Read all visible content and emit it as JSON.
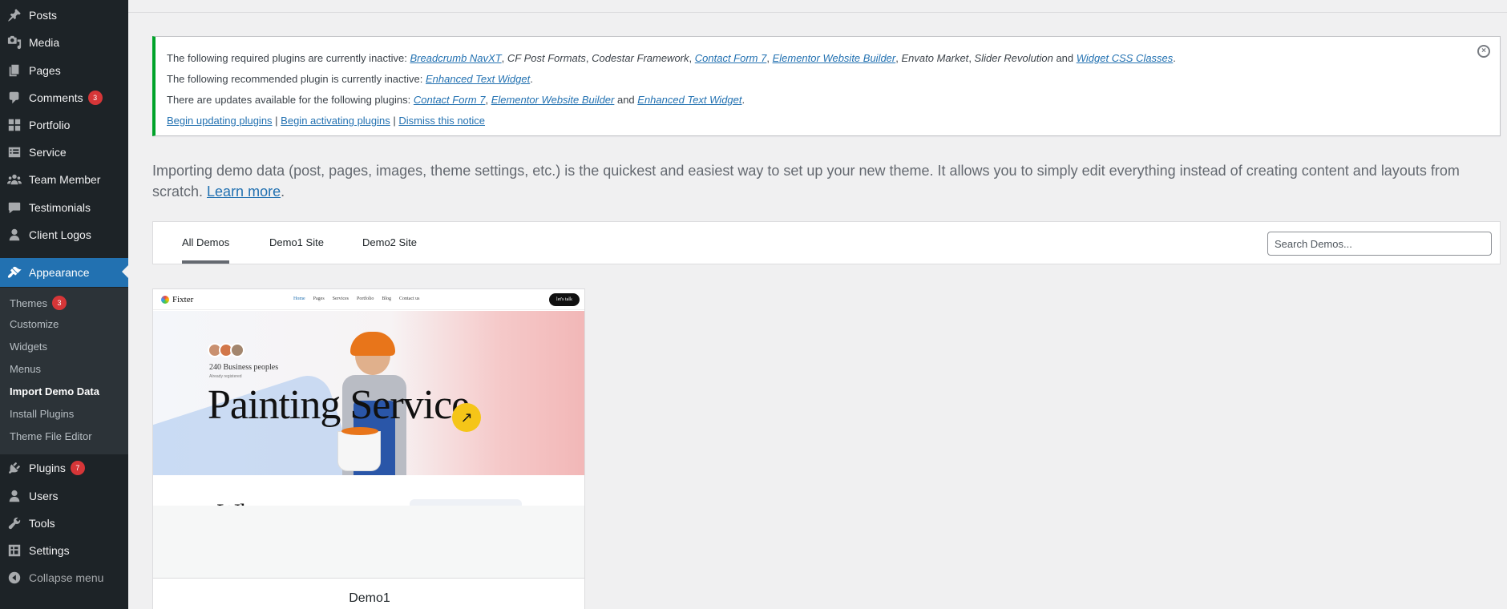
{
  "sidebar": {
    "items": [
      {
        "label": "Posts",
        "icon": "pin-icon"
      },
      {
        "label": "Media",
        "icon": "media-icon"
      },
      {
        "label": "Pages",
        "icon": "pages-icon"
      },
      {
        "label": "Comments",
        "icon": "comment-icon",
        "badge": "3"
      },
      {
        "label": "Portfolio",
        "icon": "grid-icon"
      },
      {
        "label": "Service",
        "icon": "list-icon"
      },
      {
        "label": "Team Member",
        "icon": "team-icon"
      },
      {
        "label": "Testimonials",
        "icon": "chat-icon"
      },
      {
        "label": "Client Logos",
        "icon": "user-icon"
      },
      {
        "label": "Appearance",
        "icon": "brush-icon"
      },
      {
        "label": "Plugins",
        "icon": "plug-icon",
        "badge": "7"
      },
      {
        "label": "Users",
        "icon": "users-icon"
      },
      {
        "label": "Tools",
        "icon": "wrench-icon"
      },
      {
        "label": "Settings",
        "icon": "settings-icon"
      },
      {
        "label": "Collapse menu",
        "icon": "collapse-icon"
      }
    ],
    "submenu": [
      {
        "label": "Themes",
        "badge": "3"
      },
      {
        "label": "Customize"
      },
      {
        "label": "Widgets"
      },
      {
        "label": "Menus"
      },
      {
        "label": "Import Demo Data"
      },
      {
        "label": "Install Plugins"
      },
      {
        "label": "Theme File Editor"
      }
    ]
  },
  "notice": {
    "line1_prefix": "The following required plugins are currently inactive: ",
    "line1_links": [
      "Breadcrumb NavXT",
      "Contact Form 7",
      "Elementor Website Builder",
      "Widget CSS Classes"
    ],
    "line1_plain": [
      "CF Post Formats",
      "Codestar Framework",
      "Envato Market",
      "Slider Revolution"
    ],
    "line1_and": " and ",
    "line2_prefix": "The following recommended plugin is currently inactive: ",
    "line2_link": "Enhanced Text Widget",
    "line3_prefix": "There are updates available for the following plugins: ",
    "line3_links": [
      "Contact Form 7",
      "Elementor Website Builder",
      "Enhanced Text Widget"
    ],
    "actions": [
      "Begin updating plugins",
      "Begin activating plugins",
      "Dismiss this notice"
    ]
  },
  "intro": {
    "text": "Importing demo data (post, pages, images, theme settings, etc.) is the quickest and easiest way to set up your new theme. It allows you to simply edit everything instead of creating content and layouts from scratch. ",
    "link": "Learn more",
    "suffix": "."
  },
  "tabs": [
    "All Demos",
    "Demo1 Site",
    "Demo2 Site"
  ],
  "search": {
    "placeholder": "Search Demos..."
  },
  "card": {
    "title": "Demo1",
    "preview": {
      "logo": "Fixter",
      "nav": [
        "Home",
        "Pages",
        "Services",
        "Portfolio",
        "Blog",
        "Contact us"
      ],
      "cta": "let's talk",
      "count_text": "240 Business peoples",
      "small_text": "Already registered",
      "headline": "Painting  Service",
      "lower_text": "Wh"
    }
  },
  "colors": {
    "accent": "#2271b1",
    "sidebar": "#1d2327",
    "notice_border": "#00a32a",
    "badge": "#d63638"
  }
}
